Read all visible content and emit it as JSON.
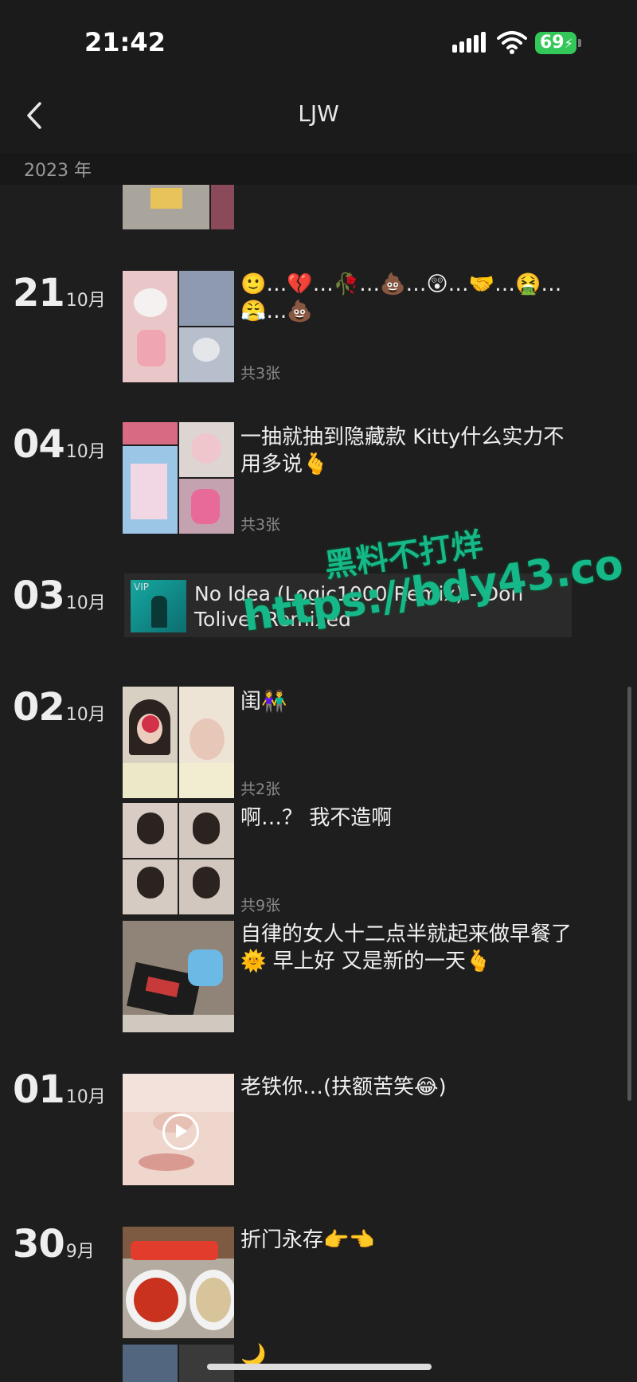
{
  "status": {
    "time": "21:42",
    "battery": "69"
  },
  "nav": {
    "title": "LJW"
  },
  "year_label": "2023 年",
  "posts": [
    {
      "day": "21",
      "month": "10月",
      "text": "🙂…💔…🥀…💩…😲…🤝…🤮…😤…💩",
      "count": "共3张"
    },
    {
      "day": "04",
      "month": "10月",
      "text": "一抽就抽到隐藏款 Kitty什么实力不用多说🫰",
      "count": "共3张"
    },
    {
      "day": "03",
      "month": "10月",
      "music_vip": "VIP",
      "music_title": "No Idea (Logic1000 Remix) - Don Toliver Remixed"
    },
    {
      "day": "02",
      "month": "10月",
      "entries": [
        {
          "text": "闺👫",
          "count": "共2张"
        },
        {
          "text": "啊…？ 我不造啊",
          "count": "共9张"
        },
        {
          "text": "自律的女人十二点半就起来做早餐了\n🌞 早上好 又是新的一天🫰"
        }
      ]
    },
    {
      "day": "01",
      "month": "10月",
      "text": "老铁你…(扶额苦笑😂)"
    },
    {
      "day": "30",
      "month": "9月",
      "text": "折门永存👉👈",
      "text2": "🌙"
    }
  ],
  "watermark": {
    "line1": "黑料不打烊",
    "line2": "https://bdy43.co"
  },
  "colors": {
    "background": "#1e1e1e",
    "battery": "#34c759",
    "watermark": "#16b88a"
  }
}
